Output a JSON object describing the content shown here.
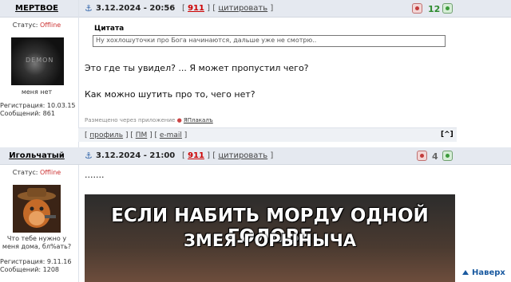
{
  "posts": [
    {
      "username": "МЕРТВОЕ",
      "date": "3.12.2024 - 20:56",
      "number": "911",
      "quote_link": "цитировать",
      "score": "12",
      "score_color": "#2e8b2e",
      "status_label": "Статус:",
      "status_value": "Offline",
      "avatar_caption": "меня нет",
      "registration": "Регистрация: 10.03.15",
      "messages": "Сообщений: 861",
      "quote_title": "Цитата",
      "quote_text": "Ну хохлошуточки про Бога начинаются, дальше уже не смотрю..",
      "text_line1": "Это где ты увидел? ... Я может пропустил чего?",
      "text_line2": "Как можно шутить про то, чего нет?",
      "posted_via": "Размещено через приложение",
      "app_name": "ЯПлакалъ",
      "footer_profile": "профиль",
      "footer_pm": "ПМ",
      "footer_email": "e-mail",
      "to_top": "[^]"
    },
    {
      "username": "Игольчатый",
      "date": "3.12.2024 - 21:00",
      "number": "911",
      "quote_link": "цитировать",
      "score": "4",
      "score_color": "#666666",
      "status_label": "Статус:",
      "status_value": "Offline",
      "avatar_caption": "Что тебе нужно у меня дома, бл%ать?",
      "registration": "Регистрация: 9.11.16",
      "messages": "Сообщений: 1208",
      "text_line1": ".......",
      "meme_line1": "ЕСЛИ НАБИТЬ МОРДУ ОДНОЙ ГОЛОВЕ",
      "meme_line2": "ЗМЕЯ-ГОРЫНЫЧА"
    }
  ],
  "scroll_top_label": "Наверх",
  "icons": [
    "anchor-icon",
    "rate-minus-icon",
    "rate-plus-icon",
    "up-arrow-icon"
  ]
}
